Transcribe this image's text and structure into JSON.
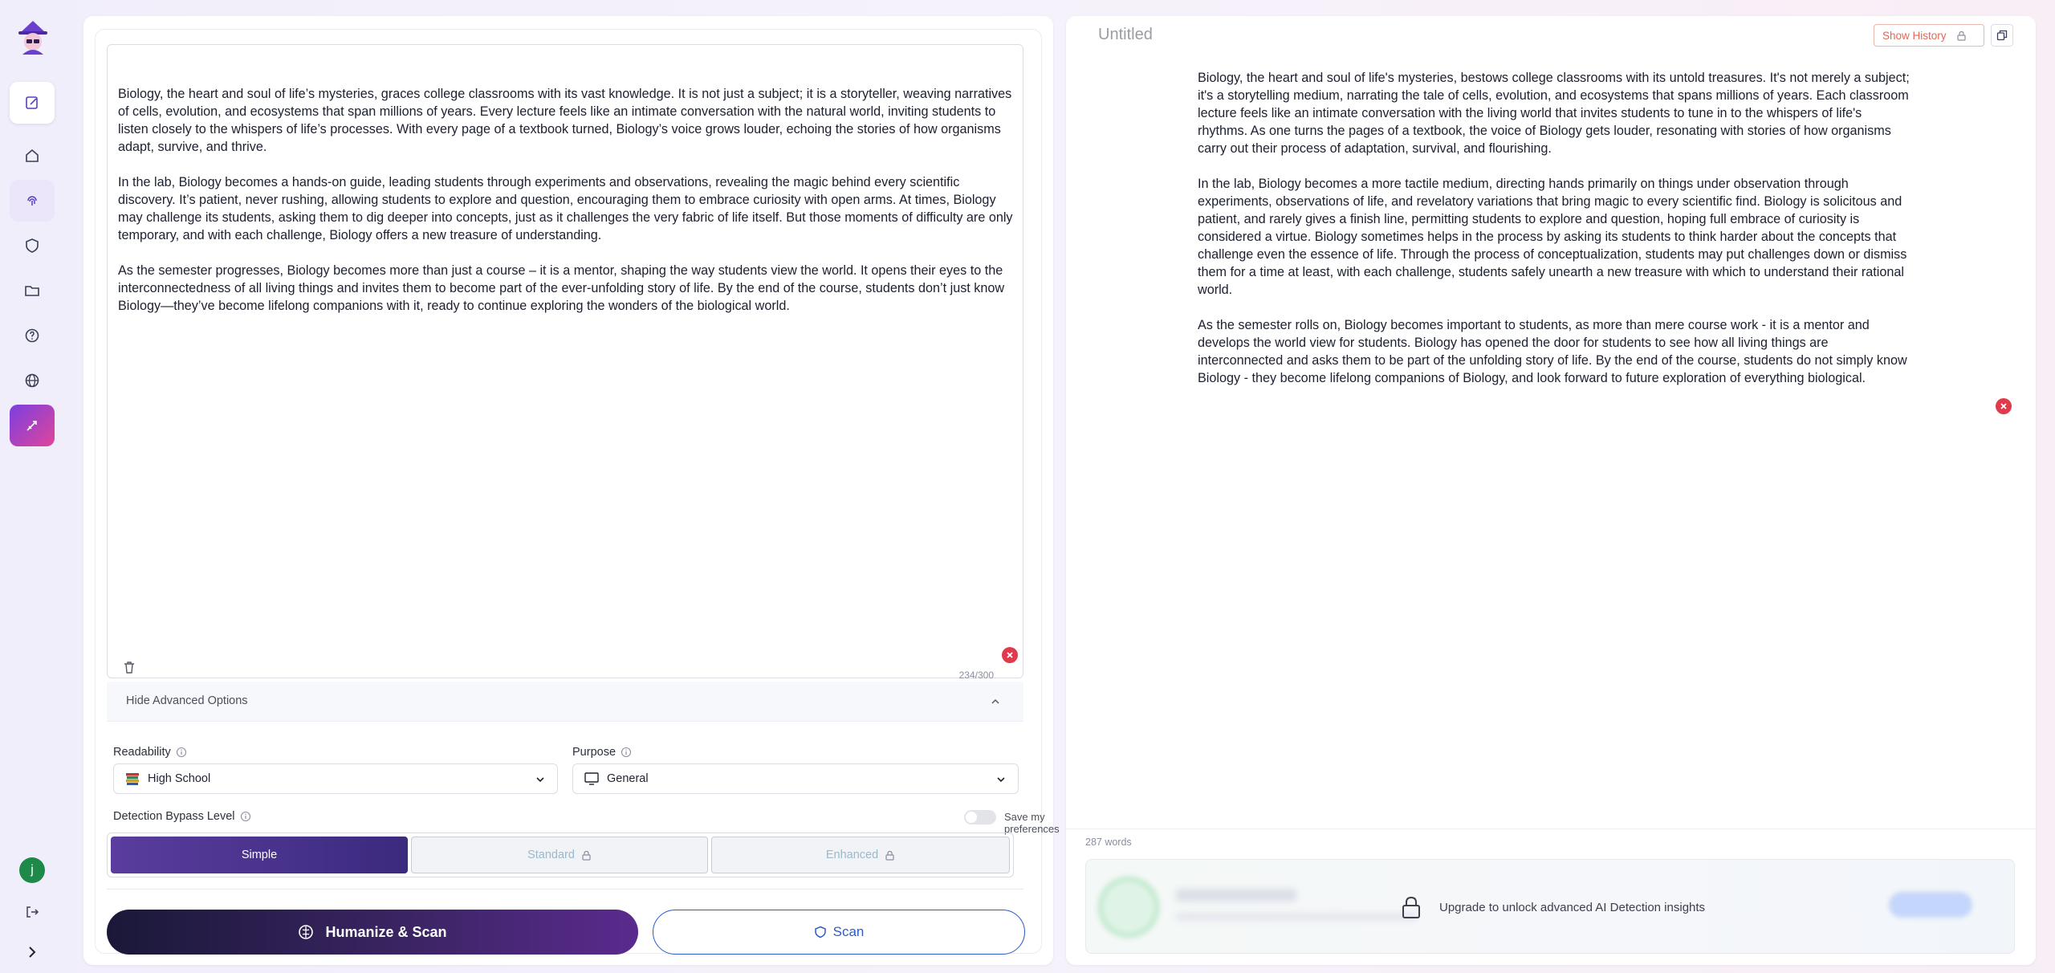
{
  "editor": {
    "paragraphs": [
      "Biology, the heart and soul of life’s mysteries, graces college classrooms with its vast knowledge. It is not just a subject; it is a storyteller, weaving narratives of cells, evolution, and ecosystems that span millions of years. Every lecture feels like an intimate conversation with the natural world, inviting students to listen closely to the whispers of life’s processes. With every page of a textbook turned, Biology’s voice grows louder, echoing the stories of how organisms adapt, survive, and thrive.",
      "In the lab, Biology becomes a hands-on guide, leading students through experiments and observations, revealing the magic behind every scientific discovery. It’s patient, never rushing, allowing students to explore and question, encouraging them to embrace curiosity with open arms. At times, Biology may challenge its students, asking them to dig deeper into concepts, just as it challenges the very fabric of life itself. But those moments of difficulty are only temporary, and with each challenge, Biology offers a new treasure of understanding.",
      "As the semester progresses, Biology becomes more than just a course – it is a mentor, shaping the way students view the world. It opens their eyes to the interconnectedness of all living things and invites them to become part of the ever-unfolding story of life. By the end of the course, students don’t just know Biology—they’ve become lifelong companions with it, ready to continue exploring the wonders of the biological world."
    ],
    "counter": "234/300"
  },
  "advanced": {
    "toggle_label": "Hide Advanced Options",
    "readability_label": "Readability",
    "readability_value": "High School",
    "purpose_label": "Purpose",
    "purpose_value": "General",
    "bypass_label": "Detection Bypass Level",
    "save_pref_label": "Save my preferences",
    "levels": [
      "Simple",
      "Standard",
      "Enhanced"
    ]
  },
  "actions": {
    "humanize_label": "Humanize & Scan",
    "scan_label": "Scan"
  },
  "output": {
    "title": "Untitled",
    "history_label": "Show History",
    "paragraphs": [
      "Biology, the heart and soul of life's mysteries, bestows college classrooms with its untold treasures. It's not merely a subject; it's a storytelling medium, narrating the tale of cells, evolution, and ecosystems that spans millions of years. Each classroom lecture feels like an intimate conversation with the living world that invites students to tune in to the whispers of life's rhythms. As one turns the pages of a textbook, the voice of Biology gets louder, resonating with stories of how organisms carry out their process of adaptation, survival, and flourishing.",
      "In the lab, Biology becomes a more tactile medium, directing hands primarily on things under observation through experiments, observations of life, and revelatory variations that bring magic to every scientific find. Biology is solicitous and patient, and rarely gives a finish line, permitting students to explore and question, hoping full embrace of curiosity is considered a virtue. Biology sometimes helps in the process by asking its students to think harder about the concepts that challenge even the essence of life. Through the process of conceptualization, students may put challenges down or dismiss them for a time at least, with each challenge, students safely unearth a new treasure with which to understand their rational world.",
      "As the semester rolls on, Biology becomes important to students, as more than mere course work - it is a mentor and develops the world view for students. Biology has opened the door for students to see how all living things are interconnected and asks them to be part of the unfolding story of life. By the end of the course, students do not simply know Biology - they become lifelong companions of Biology, and look forward to future exploration of everything biological."
    ],
    "word_count": "287 words",
    "upgrade_msg": "Upgrade to unlock advanced AI Detection insights"
  },
  "user": {
    "initial": "j"
  },
  "colors": {
    "accent": "#5a3d9e",
    "scan_blue": "#2c5cc7",
    "danger": "#e03a4d"
  }
}
